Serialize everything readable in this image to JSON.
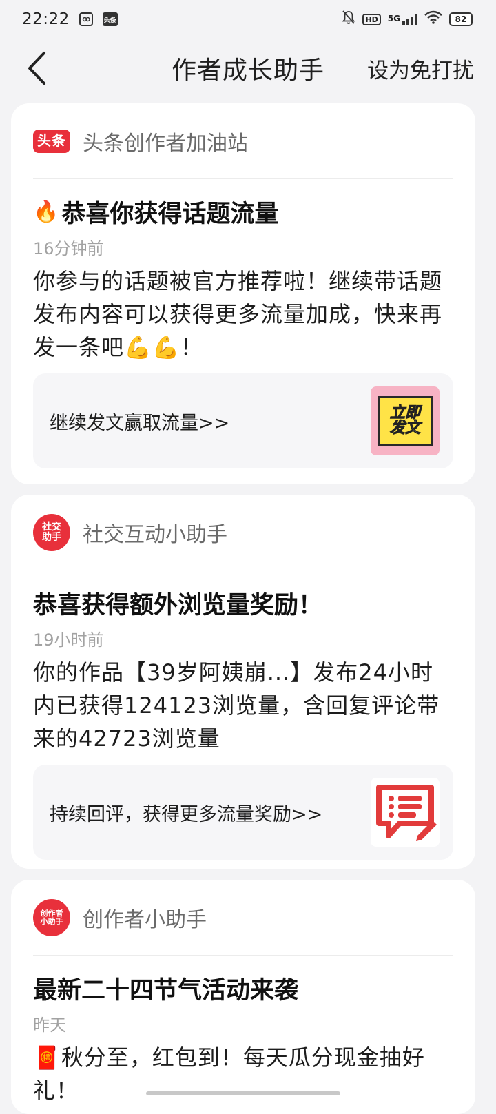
{
  "status_bar": {
    "time": "22:22",
    "app_icon_1": "⚇",
    "app_icon_2": "头条",
    "hd": "HD",
    "network": "5G",
    "battery": "82"
  },
  "nav": {
    "title": "作者成长助手",
    "dnd_label": "设为免打扰"
  },
  "cards": [
    {
      "sender_logo": "头条",
      "sender_name": "头条创作者加油站",
      "title_emoji": "🔥",
      "title": "恭喜你获得话题流量",
      "time": "16分钟前",
      "body": "你参与的话题被官方推荐啦！继续带话题发布内容可以获得更多流量加成，快来再发一条吧💪💪！",
      "action_label": "继续发文赢取流量>>",
      "thumb_line1": "立即",
      "thumb_line2": "发文"
    },
    {
      "sender_logo": "社交\n助手",
      "sender_logo_l1": "社交",
      "sender_logo_l2": "助手",
      "sender_name": "社交互动小助手",
      "title": "恭喜获得额外浏览量奖励！",
      "time": "19小时前",
      "body": "你的作品【39岁阿姨崩...】发布24小时内已获得124123浏览量，含回复评论带来的42723浏览量",
      "action_label": "持续回评，获得更多流量奖励>>"
    },
    {
      "sender_logo_l1": "创作者",
      "sender_logo_l2": "小助手",
      "sender_name": "创作者小助手",
      "title": "最新二十四节气活动来袭",
      "time": "昨天",
      "body": "🧧秋分至，红包到！每天瓜分现金抽好礼！"
    }
  ],
  "colors": {
    "brand_red": "#e8303b",
    "background": "#f3f3f5",
    "card": "#ffffff"
  }
}
